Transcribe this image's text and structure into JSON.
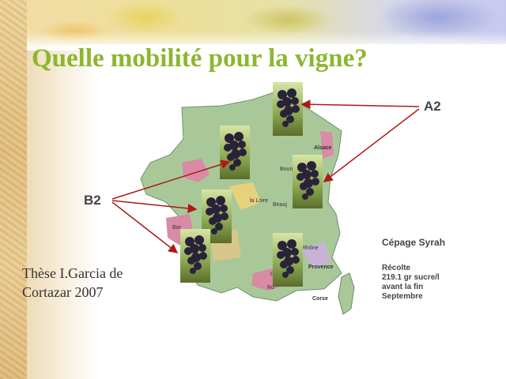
{
  "slide": {
    "title": "Quelle mobilité pour la vigne?",
    "label_a2": "A2",
    "label_b2": "B2",
    "variety": "Cépage Syrah",
    "harvest_lines": [
      "Récolte",
      "219.1 gr sucre/l",
      "avant la fin",
      "Septembre"
    ],
    "credit_lines": [
      "Thèse I.Garcia de",
      "Cortazar 2007"
    ]
  },
  "map": {
    "region_labels": [
      "Alsace",
      "Bourg",
      "la Loire",
      "Beauj",
      "Bor",
      "Côtes",
      "Rhône",
      "Provence",
      "Ro",
      "Corse"
    ]
  },
  "colors": {
    "title": "#8db62f",
    "arrow": "#b01818",
    "map_green": "#a9c89a",
    "map_pink": "#d98aa5"
  }
}
